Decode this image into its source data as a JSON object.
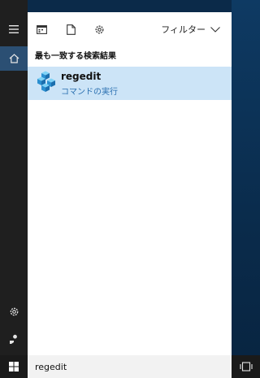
{
  "rail": {
    "items": [
      {
        "icon": "hamburger-menu-icon"
      },
      {
        "icon": "home-icon"
      },
      {
        "icon": "gear-icon"
      },
      {
        "icon": "user-feedback-icon"
      }
    ]
  },
  "toolbar": {
    "icons": [
      "apps-icon",
      "document-icon",
      "gear-icon"
    ],
    "filter_label": "フィルター"
  },
  "results": {
    "section_heading": "最も一致する検索結果",
    "best_match": {
      "title": "regedit",
      "subtitle": "コマンドの実行",
      "icon": "registry-editor-icon"
    }
  },
  "search": {
    "value": "regedit",
    "placeholder": ""
  },
  "taskbar": {
    "icons": [
      "windows-start-icon",
      "task-view-icon"
    ]
  },
  "colors": {
    "accent": "#2b4f73",
    "selection": "#cce4f7",
    "link": "#2a6fb0",
    "rail": "#1f1f1f"
  }
}
